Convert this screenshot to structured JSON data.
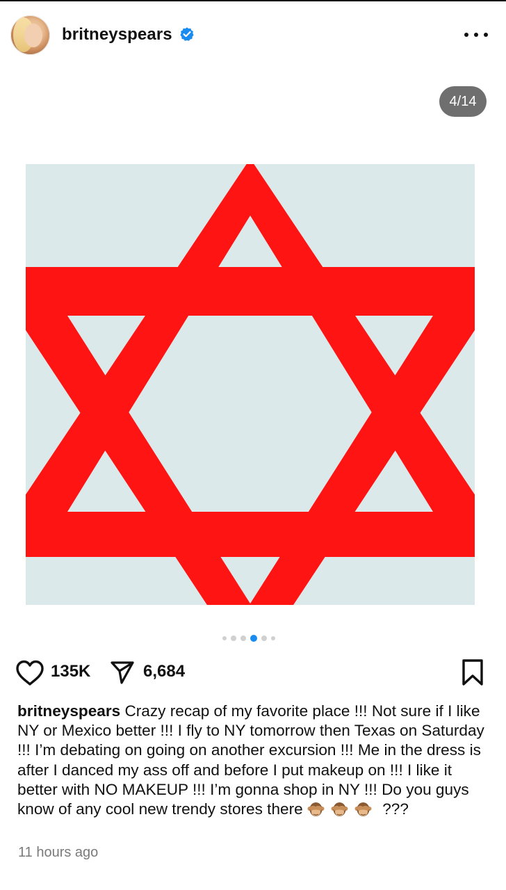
{
  "header": {
    "username": "britneyspears",
    "verified_icon": "verified-badge-icon",
    "more_icon": "more-options-icon"
  },
  "carousel": {
    "counter": "4/14",
    "active_index": 3,
    "dots": 6
  },
  "post_image": {
    "subject": "star-of-david-icon",
    "star_color": "#ff1414",
    "background_color": "#dbe9ea"
  },
  "actions": {
    "like_icon": "heart-icon",
    "likes": "135K",
    "share_icon": "send-icon",
    "shares": "6,684",
    "save_icon": "bookmark-icon"
  },
  "caption": {
    "author": "britneyspears",
    "text": "Crazy recap of my favorite place !!! Not sure if I like NY or Mexico better !!! I fly to NY tomorrow then Texas on Saturday !!! I’m debating on going on another excursion !!! Me in the dress is after I danced my ass off and before I put makeup on !!! I like it better with NO MAKEUP !!! I’m gonna shop in NY !!! Do you guys know of any cool new trendy stores there",
    "emoji": [
      "🙈",
      "🙈",
      "🙈"
    ],
    "trailing": "???"
  },
  "timestamp": "11 hours ago",
  "colors": {
    "accent_blue": "#1a8cf0",
    "counter_bg": "#6f6f6f",
    "muted_text": "#7a7a7a"
  }
}
